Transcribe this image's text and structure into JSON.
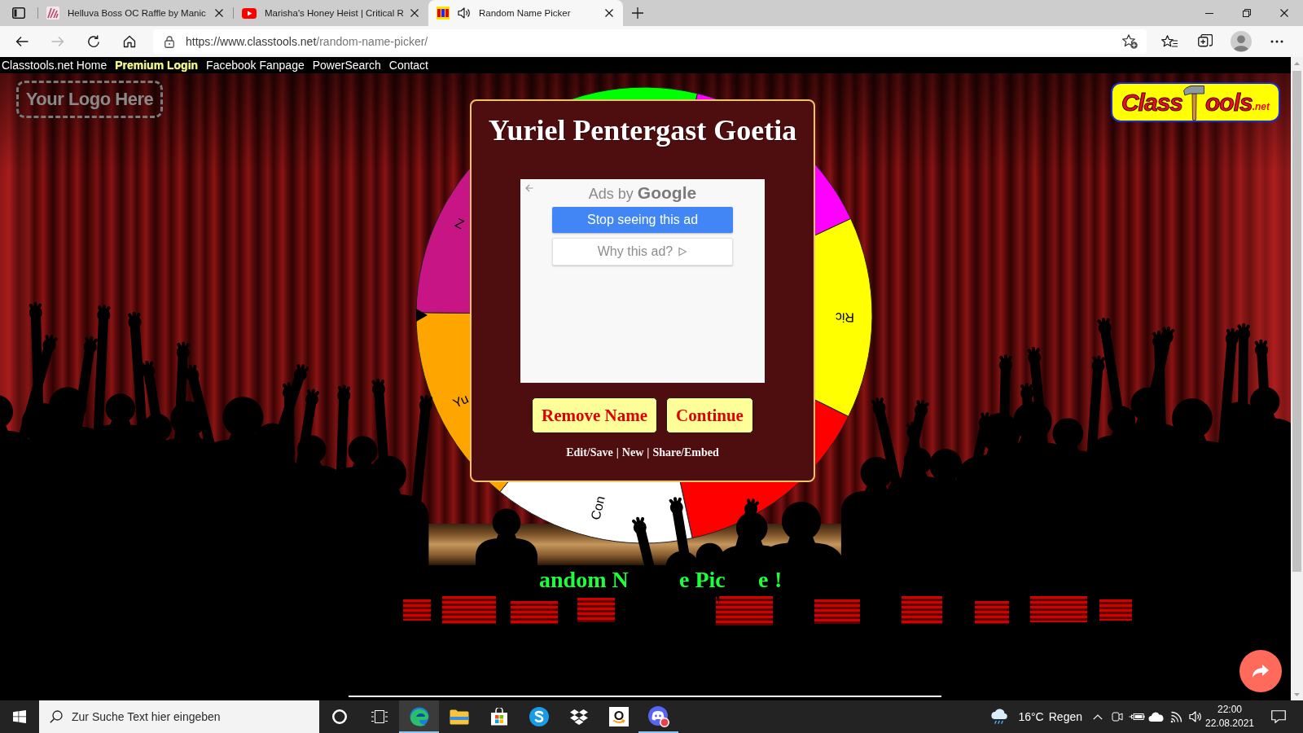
{
  "browser": {
    "tabs": [
      {
        "kind": "artwork",
        "title": "Helluva Boss OC Raffle by Manic",
        "audio": false,
        "selected": false
      },
      {
        "kind": "video",
        "title": "Marisha's Honey Heist | Critical R",
        "audio": false,
        "selected": false
      },
      {
        "kind": "classtools",
        "title": "Random Name Picker",
        "audio": true,
        "selected": true
      }
    ],
    "nav_buttons": [
      {
        "kind": "back",
        "disabled": false
      },
      {
        "kind": "forward",
        "disabled": true
      },
      {
        "kind": "refresh",
        "disabled": false
      },
      {
        "kind": "home",
        "disabled": false
      }
    ],
    "address": {
      "host": "https://www.classtools.net",
      "path": "/random-name-picker/"
    }
  },
  "site_nav": [
    {
      "label": "Classtools.net Home",
      "highlighted": false
    },
    {
      "label": "Premium Login",
      "highlighted": true
    },
    {
      "label": "Facebook Fanpage",
      "highlighted": false
    },
    {
      "label": "PowerSearch",
      "highlighted": false
    },
    {
      "label": "Contact",
      "highlighted": false
    }
  ],
  "logo_placeholder": "Your Logo Here",
  "brand_logo": {
    "text_before": "Class",
    "text_after": "ools",
    "suffix": ".net"
  },
  "wheel": {
    "segments": [
      {
        "color": "#00ff00"
      },
      {
        "color": "#ff00ff"
      },
      {
        "color": "#ffff00",
        "label": "Ric"
      },
      {
        "color": "#ff0000"
      },
      {
        "color": "#ffffff",
        "label": "Con"
      },
      {
        "color": "#ffa500",
        "label": "Yu"
      },
      {
        "color": "#c71585",
        "label": "Z"
      }
    ]
  },
  "result_dialog": {
    "name": "Yuriel Pentergast Goetia",
    "ad": {
      "label": "Ads by **Google**",
      "stop_button": "Stop seeing this ad",
      "why_button": "Why this ad?"
    },
    "buttons": [
      "Remove Name",
      "Continue"
    ],
    "links": [
      "Edit/Save",
      "New",
      "Share/Embed"
    ],
    "separator": "|"
  },
  "page_heading_fragments": [
    "andom N",
    "e Pic",
    "e",
    "!"
  ],
  "taskbar": {
    "search": {
      "placeholder": "Zur Suche Text hier eingeben"
    },
    "apps": [
      {
        "kind": "cortana",
        "selected": false,
        "running": false
      },
      {
        "kind": "task-view",
        "selected": false,
        "running": false
      },
      {
        "kind": "edge",
        "selected": true,
        "running": true
      },
      {
        "kind": "explorer",
        "selected": false,
        "running": false
      },
      {
        "kind": "store",
        "selected": false,
        "running": false
      },
      {
        "kind": "skype",
        "selected": false,
        "running": false
      },
      {
        "kind": "dropbox",
        "selected": false,
        "running": false
      },
      {
        "kind": "amazon",
        "selected": false,
        "running": false
      },
      {
        "kind": "discord",
        "selected": false,
        "running": true
      }
    ],
    "weather": {
      "temperature": "16°C",
      "condition": "Regen"
    },
    "clock": {
      "time": "22:00",
      "date": "22.08.2021"
    }
  }
}
